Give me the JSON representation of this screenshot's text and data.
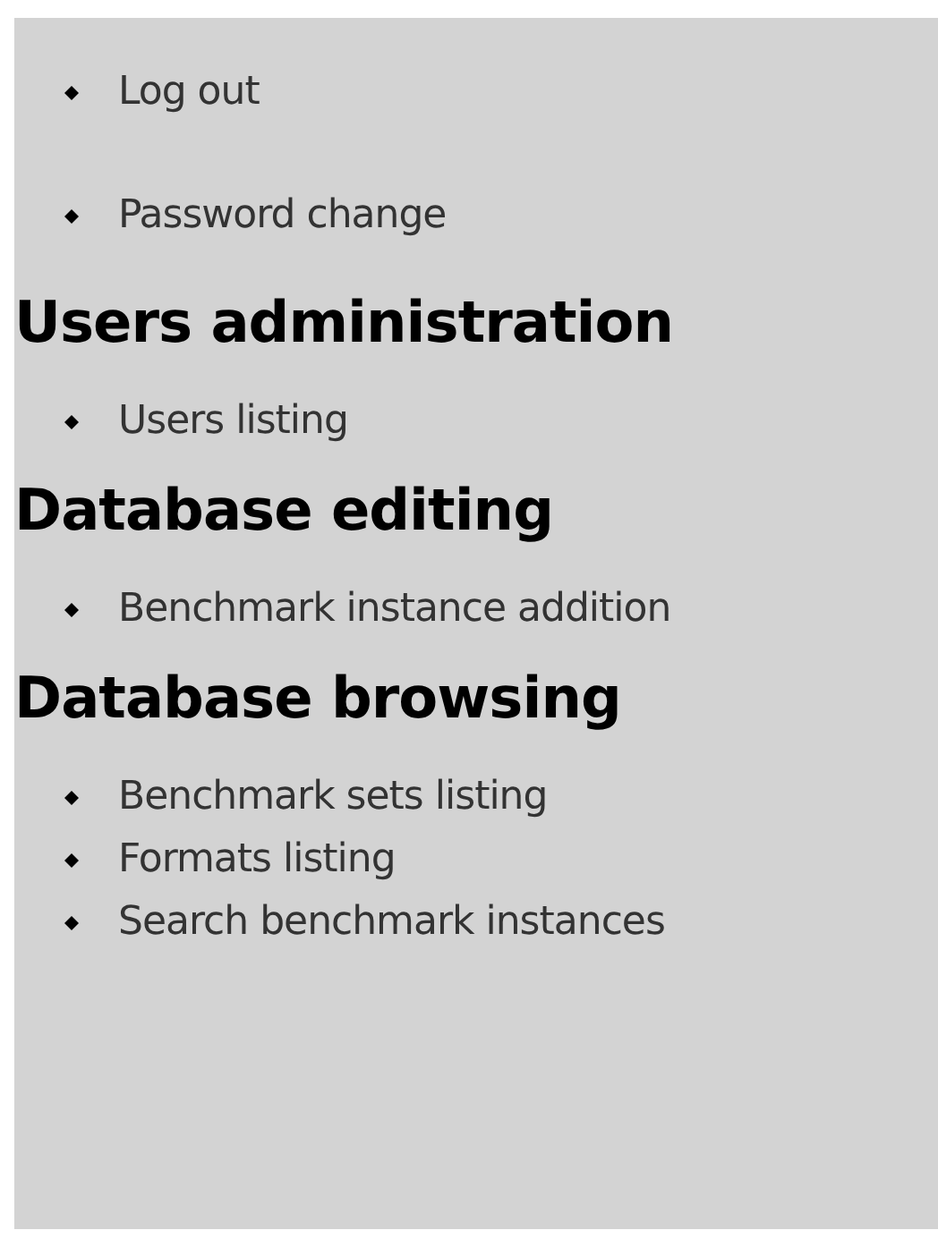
{
  "top_lists": [
    [
      {
        "label": "Log out"
      }
    ],
    [
      {
        "label": "Password change"
      }
    ]
  ],
  "sections": [
    {
      "heading": "Users administration",
      "links": [
        {
          "label": "Users listing"
        }
      ]
    },
    {
      "heading": "Database editing",
      "links": [
        {
          "label": "Benchmark instance addition"
        }
      ]
    },
    {
      "heading": "Database browsing",
      "links": [
        {
          "label": "Benchmark sets listing"
        },
        {
          "label": "Formats listing"
        },
        {
          "label": "Search benchmark instances"
        }
      ]
    }
  ]
}
